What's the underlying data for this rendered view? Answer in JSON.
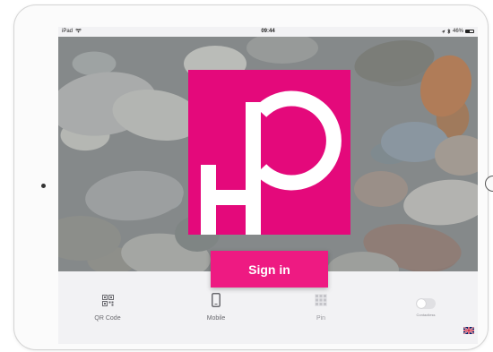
{
  "status_bar": {
    "carrier": "iPad",
    "time": "09:44",
    "battery": "46%",
    "battery_level": 0.46
  },
  "signin": {
    "label": "Sign in"
  },
  "options": {
    "qr_code": "QR Code",
    "mobile": "Mobile",
    "pin": "Pin",
    "contactless": "Contactless"
  },
  "icons": {
    "wifi": "wifi-icon",
    "location": "location-icon",
    "bluetooth": "bluetooth-icon",
    "qr": "qr-code-icon",
    "mobile": "mobile-phone-icon",
    "pin": "keypad-icon",
    "language": "uk-flag-icon"
  },
  "colors": {
    "brand": "#e4097b",
    "button": "#ee1a82",
    "text_muted": "#6b6b70"
  }
}
